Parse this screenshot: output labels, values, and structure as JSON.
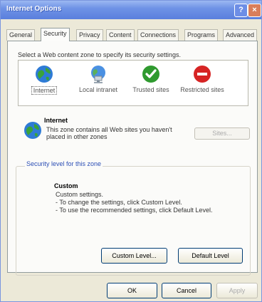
{
  "window": {
    "title": "Internet Options",
    "help_glyph": "?",
    "close_glyph": "×"
  },
  "tabs": [
    {
      "label": "General"
    },
    {
      "label": "Security"
    },
    {
      "label": "Privacy"
    },
    {
      "label": "Content"
    },
    {
      "label": "Connections"
    },
    {
      "label": "Programs"
    },
    {
      "label": "Advanced"
    }
  ],
  "security": {
    "instruction": "Select a Web content zone to specify its security settings.",
    "zones": [
      {
        "label": "Internet",
        "icon": "globe-icon"
      },
      {
        "label": "Local intranet",
        "icon": "network-icon"
      },
      {
        "label": "Trusted sites",
        "icon": "check-icon"
      },
      {
        "label": "Restricted sites",
        "icon": "restricted-icon"
      }
    ],
    "selected_zone_title": "Internet",
    "selected_zone_description": "This zone contains all Web sites you haven't placed in other zones",
    "sites_button": "Sites...",
    "group_label": "Security level for this zone",
    "level_title": "Custom",
    "level_lines": [
      "Custom settings.",
      "- To change the settings, click Custom Level.",
      "- To use the recommended settings, click Default Level."
    ],
    "custom_level_button": "Custom Level...",
    "default_level_button": "Default Level"
  },
  "footer": {
    "ok": "OK",
    "cancel": "Cancel",
    "apply": "Apply"
  }
}
